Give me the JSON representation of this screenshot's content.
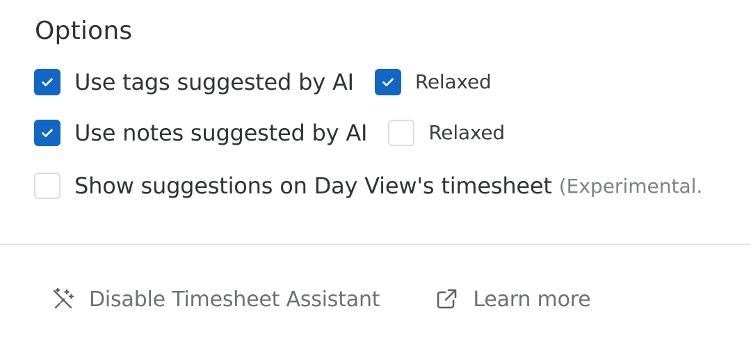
{
  "options": {
    "title": "Options",
    "items": [
      {
        "label": "Use tags suggested by AI",
        "checked": true,
        "relaxed": {
          "label": "Relaxed",
          "checked": true
        }
      },
      {
        "label": "Use notes suggested by AI",
        "checked": true,
        "relaxed": {
          "label": "Relaxed",
          "checked": false
        }
      },
      {
        "label": "Show suggestions on Day View's timesheet",
        "checked": false,
        "note": "(Experimental."
      }
    ]
  },
  "footer": {
    "disable_label": "Disable Timesheet Assistant",
    "disable_icon": "magic-wand-off-icon",
    "learn_label": "Learn more",
    "learn_icon": "external-link-icon"
  },
  "colors": {
    "accent": "#1267c4",
    "text": "#2f3237",
    "muted": "#7d8086",
    "divider": "#e4e5e8"
  }
}
